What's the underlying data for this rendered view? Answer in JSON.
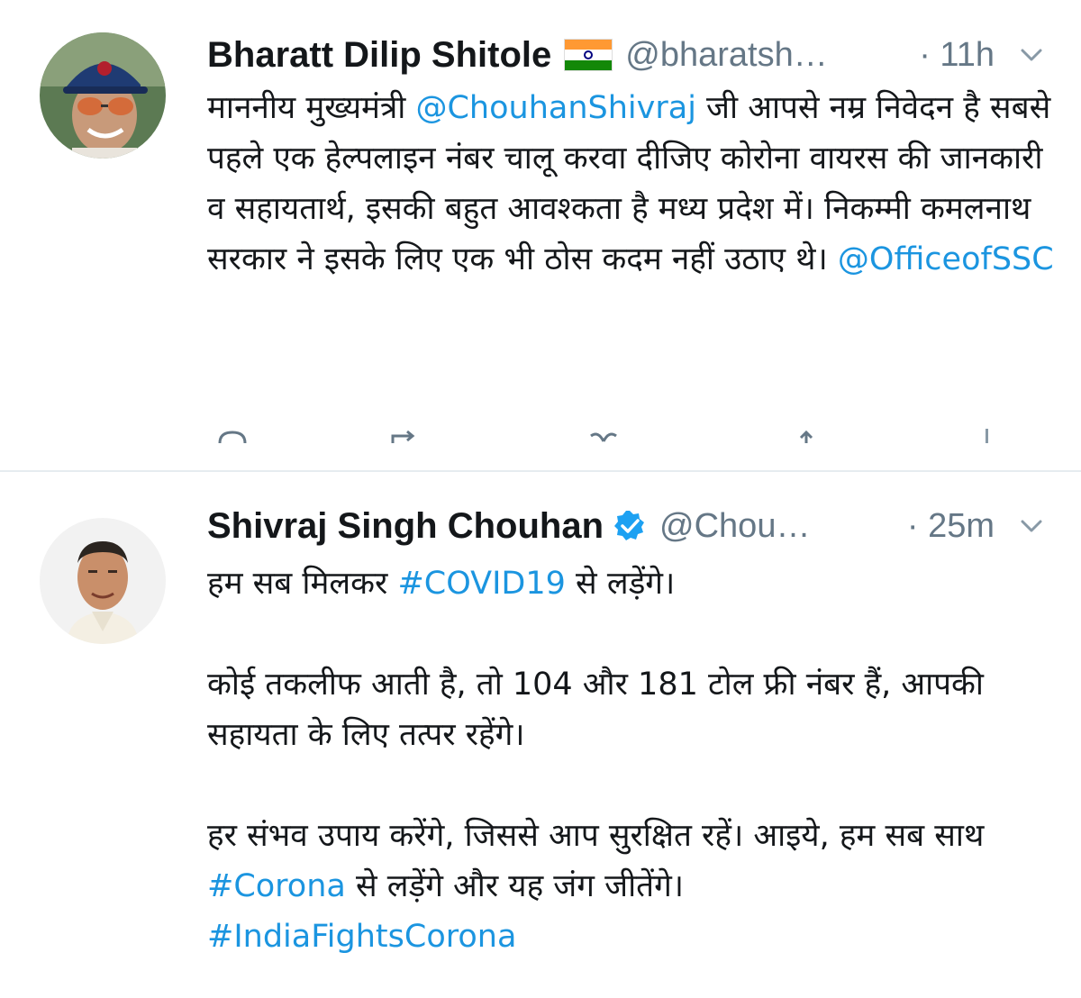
{
  "tweets": [
    {
      "author_name": "Bharatt Dilip Shitole",
      "flag_icon": "india-flag-icon",
      "handle": "@bharatsh…",
      "time": "· 11h",
      "text_segments": [
        {
          "text": "माननीय मुख्यमंत्री ",
          "link": false
        },
        {
          "text": "@ChouhanShivraj",
          "link": true
        },
        {
          "text": " जी आपसे नम्र निवेदन है सबसे पहले एक हेल्पलाइन नंबर चालू करवा दीजिए कोरोना वायरस की जानकारी व सहायतार्थ, इसकी बहुत आवश्कता है मध्य प्रदेश में। निकम्मी कमलनाथ सरकार ने इसके लिए एक भी ठोस कदम नहीं उठाए थे। ",
          "link": false
        },
        {
          "text": "@OfficeofSSC",
          "link": true
        }
      ],
      "action_icons": [
        "reply-icon",
        "retweet-icon",
        "like-icon",
        "share-icon"
      ]
    },
    {
      "author_name": "Shivraj Singh Chouhan",
      "verified_icon": "verified-badge-icon",
      "handle": "@Chou…",
      "time": "· 25m",
      "paragraphs": [
        [
          {
            "text": "हम सब मिलकर ",
            "link": false
          },
          {
            "text": "#COVID19",
            "link": true
          },
          {
            "text": " से लड़ेंगे।",
            "link": false
          }
        ],
        [
          {
            "text": "कोई तकलीफ आती है, तो 104 और 181 टोल फ्री नंबर हैं, आपकी सहायता के लिए तत्पर रहेंगे।",
            "link": false
          }
        ],
        [
          {
            "text": "हर संभव उपाय करेंगे, जिससे आप सुरक्षित रहें। आइये, हम सब साथ ",
            "link": false
          },
          {
            "text": "#Corona",
            "link": true
          },
          {
            "text": " से लड़ेंगे और  यह जंग जीतेंगे।",
            "link": false
          },
          {
            "text": "#IndiaFightsCorona",
            "link": true
          }
        ]
      ]
    }
  ],
  "colors": {
    "link": "#1b95e0",
    "secondary_text": "#657786",
    "primary_text": "#14171a",
    "divider": "#e6ecf0",
    "verified": "#1da1f2"
  }
}
